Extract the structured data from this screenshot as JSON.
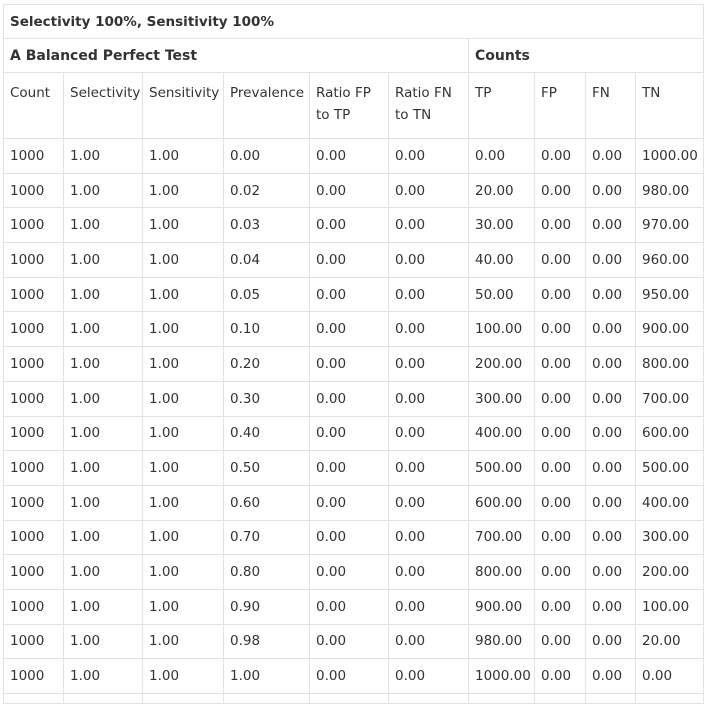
{
  "title": "Selectivity 100%, Sensitivity 100%",
  "groups": {
    "left": "A Balanced Perfect Test",
    "right": "Counts"
  },
  "headers": [
    "Count",
    "Selectivity",
    "Sensitivity",
    "Prevalence",
    "Ratio FP to TP",
    "Ratio FN to TN",
    "TP",
    "FP",
    "FN",
    "TN"
  ],
  "rows": [
    [
      "1000",
      "1.00",
      "1.00",
      "0.00",
      "0.00",
      "0.00",
      "0.00",
      "0.00",
      "0.00",
      "1000.00"
    ],
    [
      "1000",
      "1.00",
      "1.00",
      "0.02",
      "0.00",
      "0.00",
      "20.00",
      "0.00",
      "0.00",
      "980.00"
    ],
    [
      "1000",
      "1.00",
      "1.00",
      "0.03",
      "0.00",
      "0.00",
      "30.00",
      "0.00",
      "0.00",
      "970.00"
    ],
    [
      "1000",
      "1.00",
      "1.00",
      "0.04",
      "0.00",
      "0.00",
      "40.00",
      "0.00",
      "0.00",
      "960.00"
    ],
    [
      "1000",
      "1.00",
      "1.00",
      "0.05",
      "0.00",
      "0.00",
      "50.00",
      "0.00",
      "0.00",
      "950.00"
    ],
    [
      "1000",
      "1.00",
      "1.00",
      "0.10",
      "0.00",
      "0.00",
      "100.00",
      "0.00",
      "0.00",
      "900.00"
    ],
    [
      "1000",
      "1.00",
      "1.00",
      "0.20",
      "0.00",
      "0.00",
      "200.00",
      "0.00",
      "0.00",
      "800.00"
    ],
    [
      "1000",
      "1.00",
      "1.00",
      "0.30",
      "0.00",
      "0.00",
      "300.00",
      "0.00",
      "0.00",
      "700.00"
    ],
    [
      "1000",
      "1.00",
      "1.00",
      "0.40",
      "0.00",
      "0.00",
      "400.00",
      "0.00",
      "0.00",
      "600.00"
    ],
    [
      "1000",
      "1.00",
      "1.00",
      "0.50",
      "0.00",
      "0.00",
      "500.00",
      "0.00",
      "0.00",
      "500.00"
    ],
    [
      "1000",
      "1.00",
      "1.00",
      "0.60",
      "0.00",
      "0.00",
      "600.00",
      "0.00",
      "0.00",
      "400.00"
    ],
    [
      "1000",
      "1.00",
      "1.00",
      "0.70",
      "0.00",
      "0.00",
      "700.00",
      "0.00",
      "0.00",
      "300.00"
    ],
    [
      "1000",
      "1.00",
      "1.00",
      "0.80",
      "0.00",
      "0.00",
      "800.00",
      "0.00",
      "0.00",
      "200.00"
    ],
    [
      "1000",
      "1.00",
      "1.00",
      "0.90",
      "0.00",
      "0.00",
      "900.00",
      "0.00",
      "0.00",
      "100.00"
    ],
    [
      "1000",
      "1.00",
      "1.00",
      "0.98",
      "0.00",
      "0.00",
      "980.00",
      "0.00",
      "0.00",
      "20.00"
    ],
    [
      "1000",
      "1.00",
      "1.00",
      "1.00",
      "0.00",
      "0.00",
      "1000.00",
      "0.00",
      "0.00",
      "0.00"
    ]
  ]
}
